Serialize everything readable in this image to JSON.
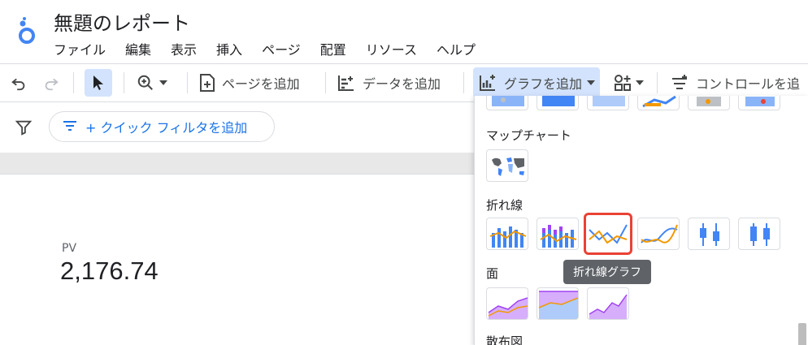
{
  "app": {
    "title": "無題のレポート"
  },
  "menu": [
    "ファイル",
    "編集",
    "表示",
    "挿入",
    "ページ",
    "配置",
    "リソース",
    "ヘルプ"
  ],
  "toolbar": {
    "add_page": "ページを追加",
    "add_data": "データを追加",
    "add_chart": "グラフを追加",
    "add_control": "コントロールを追"
  },
  "filter": {
    "quick_filter": "+ クイック フィルタを追加"
  },
  "scorecard": {
    "label": "PV",
    "value": "2,176.74"
  },
  "panel": {
    "map_section": "マップチャート",
    "line_section": "折れ線",
    "area_section": "面",
    "scatter_section": "散布図"
  },
  "tooltip": "折れ線グラフ",
  "colors": {
    "accent": "#1a73e8",
    "selected_bg": "#d3e3fd",
    "highlight": "#e94235",
    "orange": "#f29900"
  }
}
